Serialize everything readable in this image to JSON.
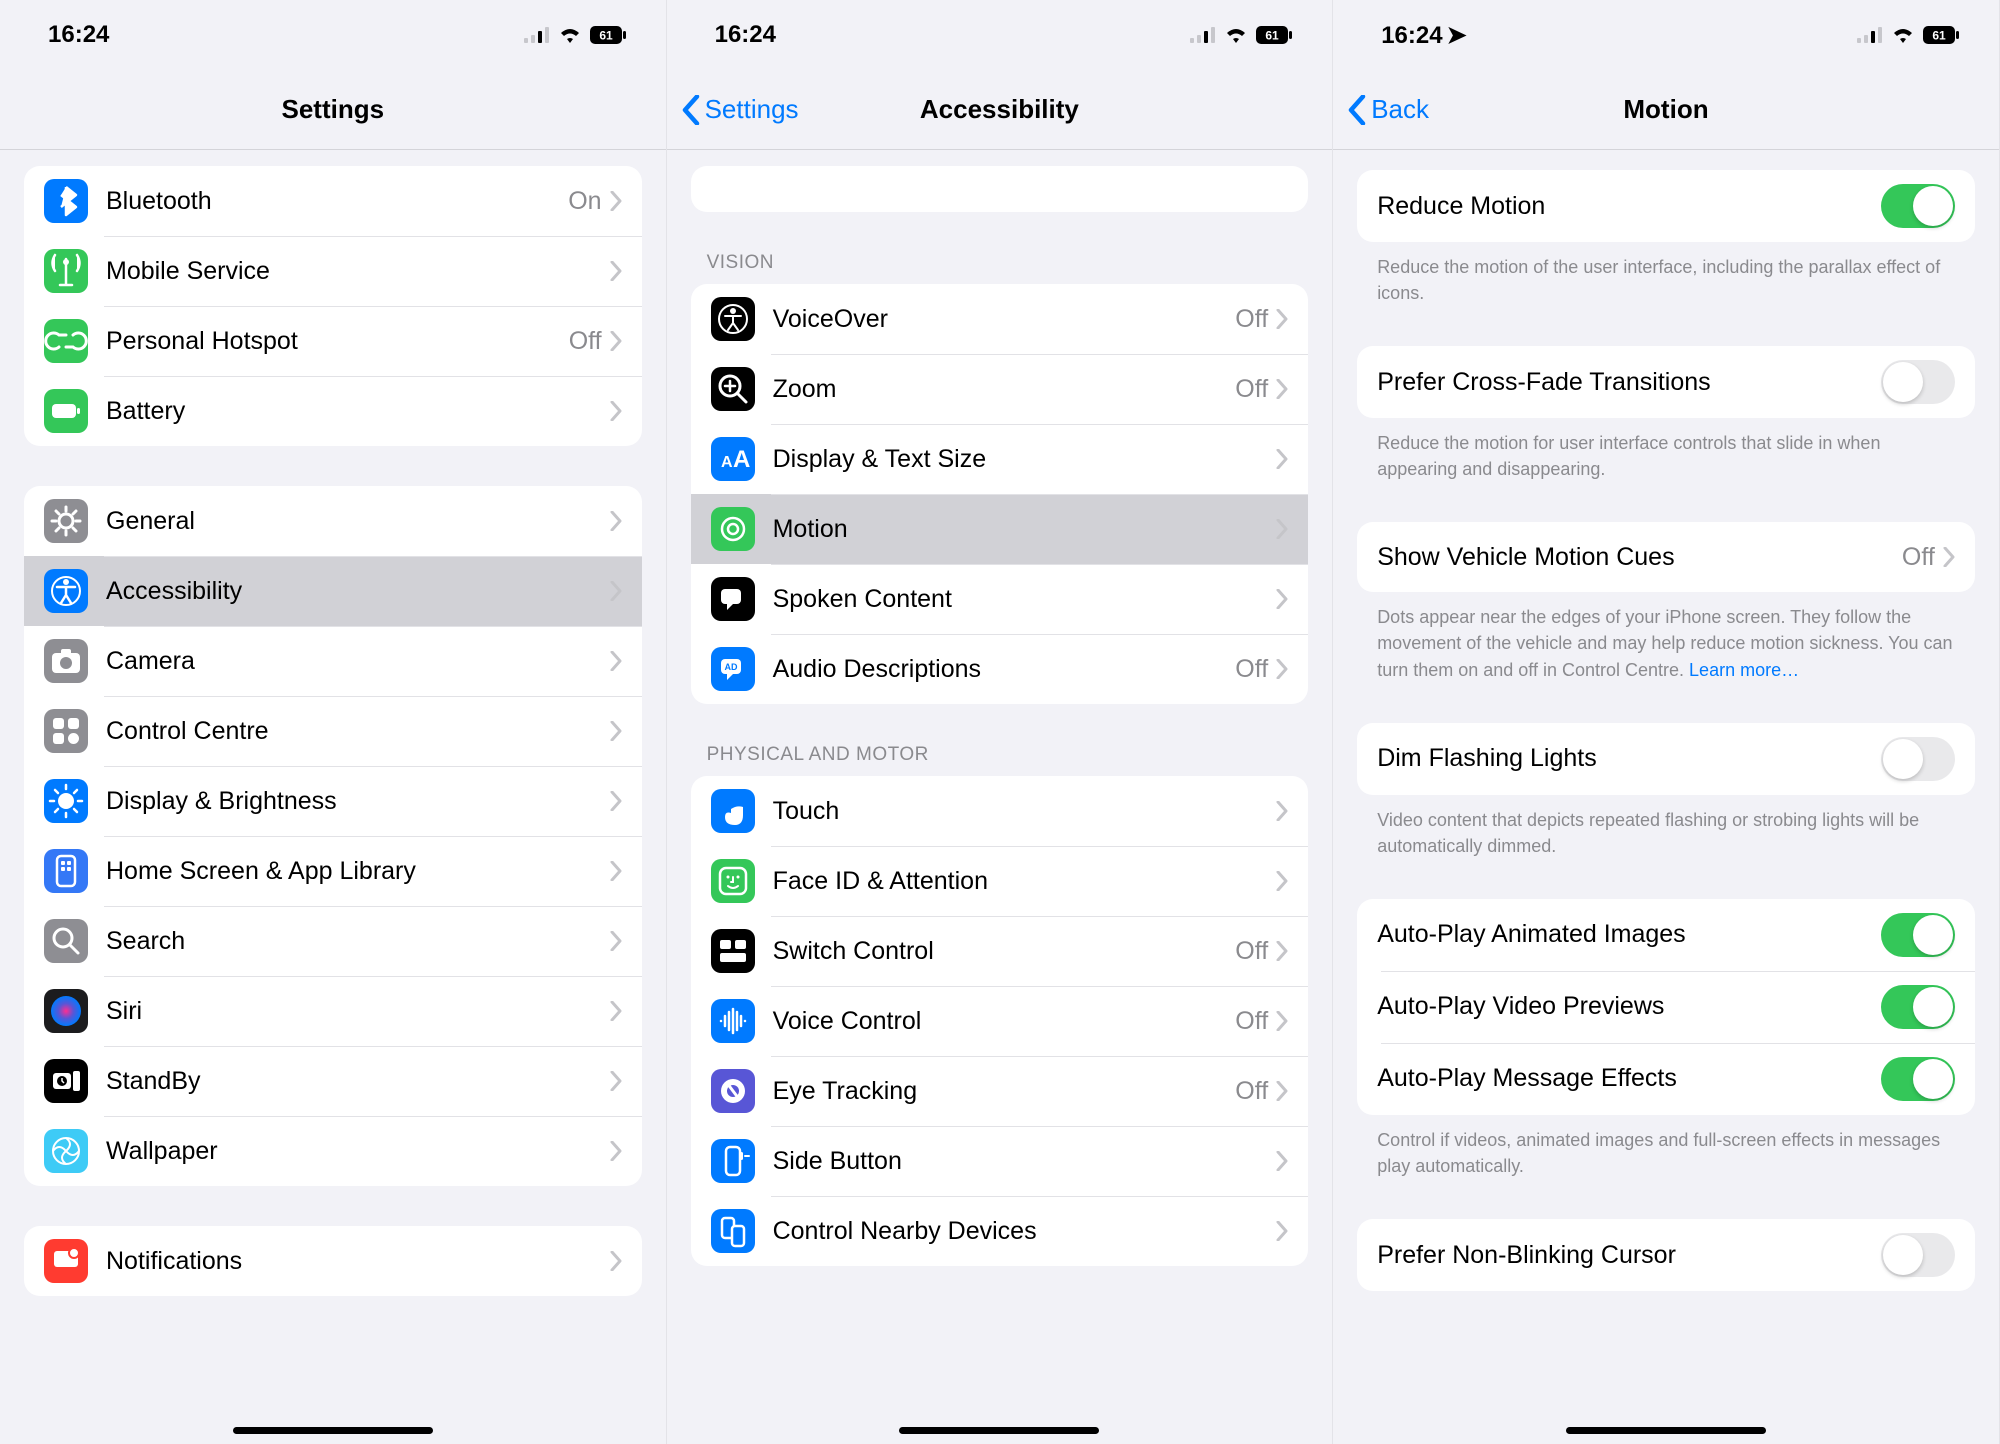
{
  "status": {
    "time": "16:24",
    "battery": "61"
  },
  "p1": {
    "title": "Settings",
    "group1": [
      {
        "name": "bluetooth",
        "label": "Bluetooth",
        "value": "On",
        "iconBg": "#007aff"
      },
      {
        "name": "mobile-service",
        "label": "Mobile Service",
        "iconBg": "#34c759"
      },
      {
        "name": "personal-hotspot",
        "label": "Personal Hotspot",
        "value": "Off",
        "iconBg": "#34c759"
      },
      {
        "name": "battery",
        "label": "Battery",
        "iconBg": "#34c759"
      }
    ],
    "group2": [
      {
        "name": "general",
        "label": "General",
        "iconBg": "#8e8e93"
      },
      {
        "name": "accessibility",
        "label": "Accessibility",
        "iconBg": "#007aff",
        "selected": true
      },
      {
        "name": "camera",
        "label": "Camera",
        "iconBg": "#8e8e93"
      },
      {
        "name": "control-centre",
        "label": "Control Centre",
        "iconBg": "#8e8e93"
      },
      {
        "name": "display",
        "label": "Display & Brightness",
        "iconBg": "#007aff"
      },
      {
        "name": "home-screen",
        "label": "Home Screen & App Library",
        "iconBg": "#3478f6"
      },
      {
        "name": "search",
        "label": "Search",
        "iconBg": "#8e8e93"
      },
      {
        "name": "siri",
        "label": "Siri",
        "iconBg": "#1c1c1e"
      },
      {
        "name": "standby",
        "label": "StandBy",
        "iconBg": "#000"
      },
      {
        "name": "wallpaper",
        "label": "Wallpaper",
        "iconBg": "#3ecbf6"
      }
    ],
    "group3": [
      {
        "name": "notifications",
        "label": "Notifications",
        "iconBg": "#ff3b30"
      }
    ]
  },
  "p2": {
    "back": "Settings",
    "title": "Accessibility",
    "sectionVision": "VISION",
    "vision": [
      {
        "name": "voiceover",
        "label": "VoiceOver",
        "value": "Off",
        "iconBg": "#000"
      },
      {
        "name": "zoom",
        "label": "Zoom",
        "value": "Off",
        "iconBg": "#000"
      },
      {
        "name": "display-text",
        "label": "Display & Text Size",
        "iconBg": "#007aff"
      },
      {
        "name": "motion",
        "label": "Motion",
        "iconBg": "#34c759",
        "selected": true
      },
      {
        "name": "spoken-content",
        "label": "Spoken Content",
        "iconBg": "#000"
      },
      {
        "name": "audio-desc",
        "label": "Audio Descriptions",
        "value": "Off",
        "iconBg": "#007aff"
      }
    ],
    "sectionMotor": "PHYSICAL AND MOTOR",
    "motor": [
      {
        "name": "touch",
        "label": "Touch",
        "iconBg": "#007aff"
      },
      {
        "name": "faceid",
        "label": "Face ID & Attention",
        "iconBg": "#34c759"
      },
      {
        "name": "switch-control",
        "label": "Switch Control",
        "value": "Off",
        "iconBg": "#000"
      },
      {
        "name": "voice-control",
        "label": "Voice Control",
        "value": "Off",
        "iconBg": "#007aff"
      },
      {
        "name": "eye-tracking",
        "label": "Eye Tracking",
        "value": "Off",
        "iconBg": "#5856d6"
      },
      {
        "name": "side-button",
        "label": "Side Button",
        "iconBg": "#007aff"
      },
      {
        "name": "nearby-devices",
        "label": "Control Nearby Devices",
        "iconBg": "#007aff"
      }
    ]
  },
  "p3": {
    "back": "Back",
    "title": "Motion",
    "showLocation": true,
    "rows": [
      {
        "type": "toggle",
        "name": "reduce-motion",
        "label": "Reduce Motion",
        "on": true,
        "footer": "Reduce the motion of the user interface, including the parallax effect of icons."
      },
      {
        "type": "toggle",
        "name": "cross-fade",
        "label": "Prefer Cross-Fade Transitions",
        "on": false,
        "footer": "Reduce the motion for user interface controls that slide in when appearing and disappearing."
      },
      {
        "type": "nav",
        "name": "vehicle-cues",
        "label": "Show Vehicle Motion Cues",
        "value": "Off",
        "footer": "Dots appear near the edges of your iPhone screen. They follow the movement of the vehicle and may help reduce motion sickness. You can turn them on and off in Control Centre.",
        "link": "Learn more…"
      },
      {
        "type": "toggle",
        "name": "dim-flashing",
        "label": "Dim Flashing Lights",
        "on": false,
        "footer": "Video content that depicts repeated flashing or strobing lights will be automatically dimmed."
      },
      {
        "type": "toggle-group",
        "items": [
          {
            "name": "auto-images",
            "label": "Auto-Play Animated Images",
            "on": true
          },
          {
            "name": "auto-video",
            "label": "Auto-Play Video Previews",
            "on": true
          },
          {
            "name": "auto-message",
            "label": "Auto-Play Message Effects",
            "on": true
          }
        ],
        "footer": "Control if videos, animated images and full-screen effects in messages play automatically."
      },
      {
        "type": "toggle",
        "name": "non-blinking",
        "label": "Prefer Non-Blinking Cursor",
        "on": false
      }
    ]
  }
}
